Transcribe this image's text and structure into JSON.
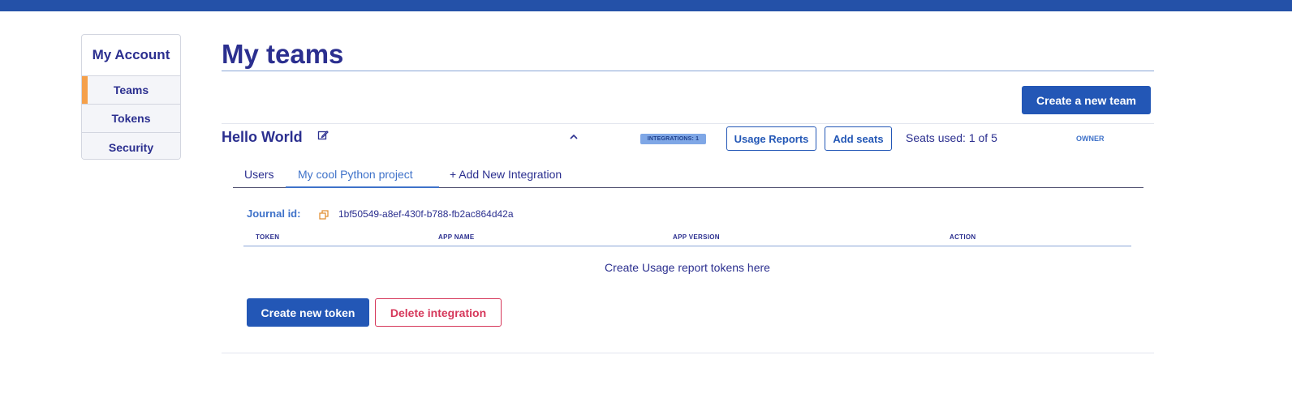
{
  "sidebar": {
    "title": "My Account",
    "items": [
      {
        "label": "Teams",
        "active": true
      },
      {
        "label": "Tokens",
        "active": false
      },
      {
        "label": "Security",
        "active": false
      }
    ]
  },
  "main": {
    "title": "My teams",
    "create_team_label": "Create a new team",
    "team": {
      "name": "Hello World",
      "integrations_badge": "INTEGRATIONS: 1",
      "usage_reports_label": "Usage Reports",
      "add_seats_label": "Add seats",
      "seats_used": "Seats used: 1 of 5",
      "role": "OWNER",
      "tabs": [
        {
          "label": "Users",
          "active": false
        },
        {
          "label": "My cool Python project",
          "active": true
        },
        {
          "label": "+ Add New Integration",
          "active": false
        }
      ],
      "journal_label": "Journal id:",
      "journal_id": "1bf50549-a8ef-430f-b788-fb2ac864d42a",
      "table": {
        "columns": [
          "TOKEN",
          "APP NAME",
          "APP VERSION",
          "ACTION"
        ],
        "empty_message": "Create Usage report tokens here"
      },
      "create_token_label": "Create new token",
      "delete_integration_label": "Delete integration"
    }
  },
  "colors": {
    "topbar": "#2451a8",
    "primary": "#2357b6",
    "text": "#2b2f8f",
    "accent_active": "#f5a04a",
    "danger": "#d6375a",
    "badge": "#7fa7e6"
  },
  "icons": [
    "edit-icon",
    "chevron-up-icon",
    "copy-icon"
  ]
}
